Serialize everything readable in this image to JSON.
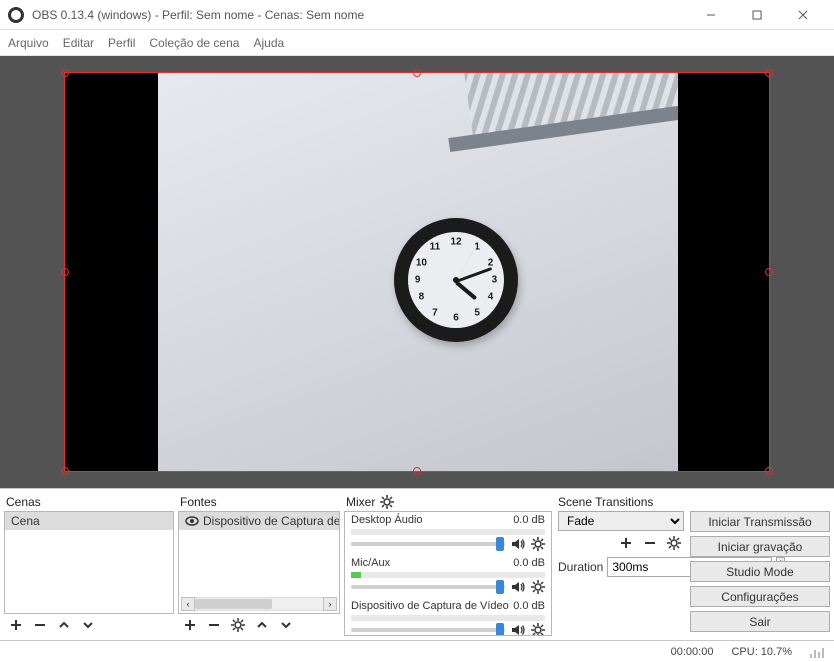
{
  "window": {
    "title": "OBS 0.13.4 (windows) - Perfil: Sem nome - Cenas: Sem nome"
  },
  "menu": {
    "file": "Arquivo",
    "edit": "Editar",
    "profile": "Perfil",
    "scene_collection": "Coleção de cena",
    "help": "Ajuda"
  },
  "panels": {
    "scenes": {
      "title": "Cenas",
      "items": [
        "Cena"
      ]
    },
    "sources": {
      "title": "Fontes",
      "items": [
        "Dispositivo de Captura de Vídeo"
      ]
    },
    "mixer": {
      "title": "Mixer",
      "channels": [
        {
          "name": "Desktop Áudio",
          "db": "0.0 dB",
          "slider": 94,
          "level": 0
        },
        {
          "name": "Mic/Aux",
          "db": "0.0 dB",
          "slider": 94,
          "level": 5
        },
        {
          "name": "Dispositivo de Captura de Vídeo",
          "db": "0.0 dB",
          "slider": 94,
          "level": 0
        }
      ]
    },
    "transitions": {
      "title": "Scene Transitions",
      "selected": "Fade",
      "duration_label": "Duration",
      "duration_value": "300ms"
    },
    "controls": {
      "start_stream": "Iniciar Transmissão",
      "start_record": "Iniciar gravação",
      "studio_mode": "Studio Mode",
      "settings": "Configurações",
      "exit": "Sair"
    }
  },
  "statusbar": {
    "time": "00:00:00",
    "cpu": "CPU: 10.7%"
  },
  "clock": {
    "numbers": {
      "12": "12",
      "1": "1",
      "2": "2",
      "3": "3",
      "4": "4",
      "5": "5",
      "6": "6",
      "7": "7",
      "8": "8",
      "9": "9",
      "10": "10",
      "11": "11"
    },
    "hour_angle": 130,
    "minute_angle": 70,
    "second_angle": 30
  }
}
